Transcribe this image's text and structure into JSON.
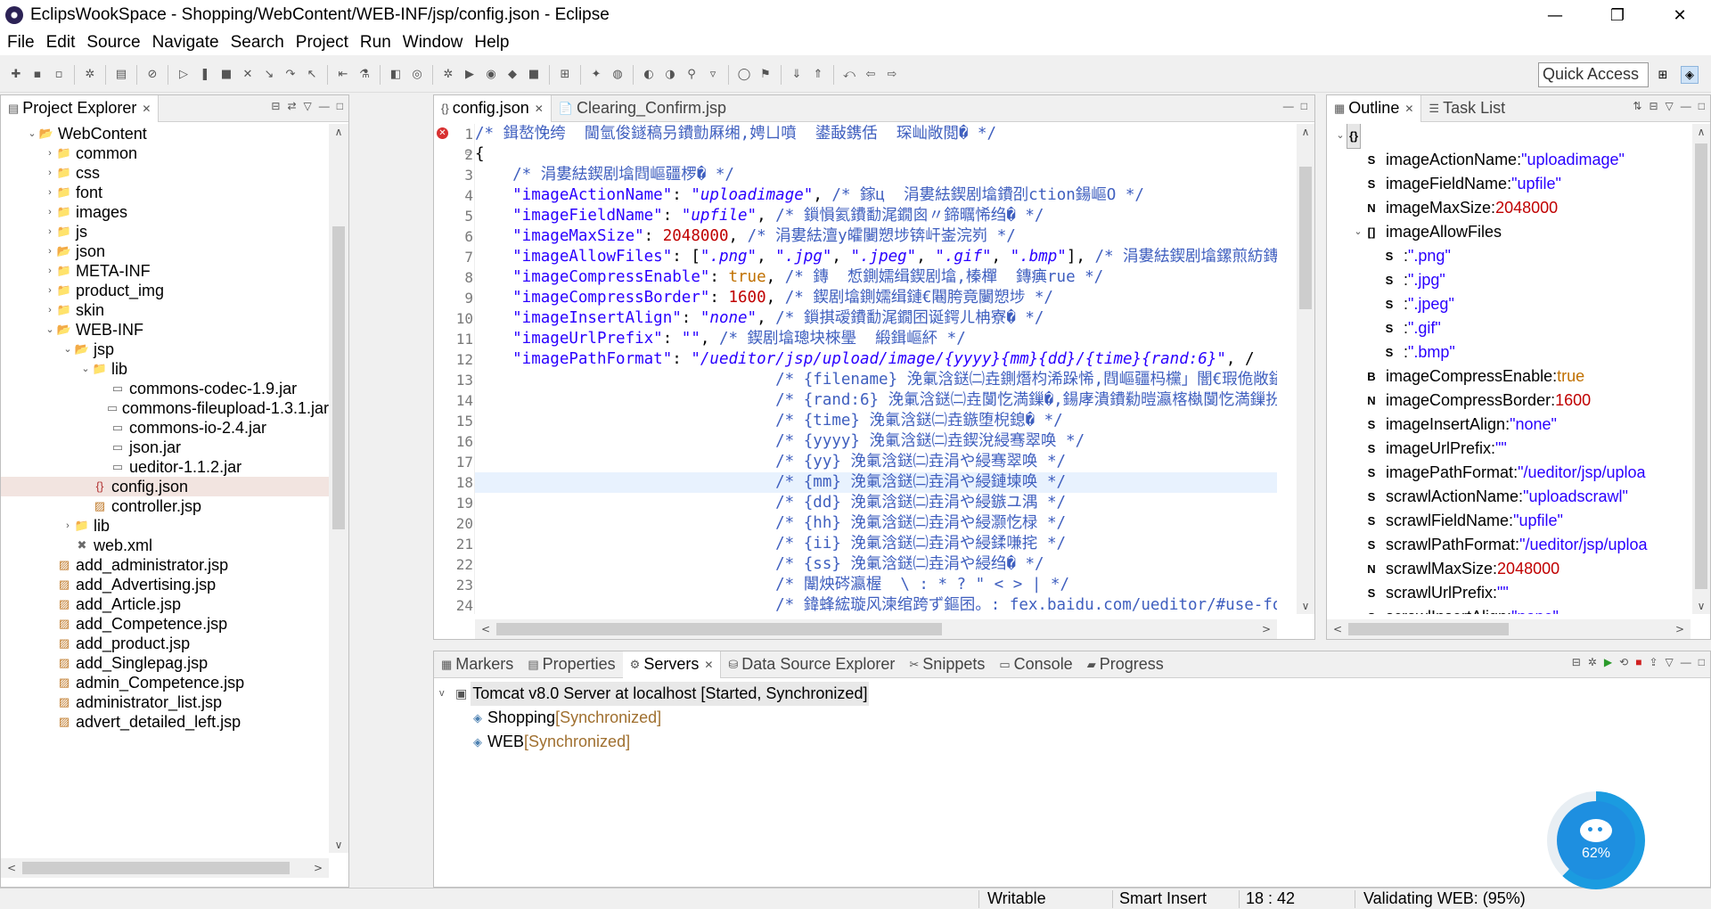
{
  "window": {
    "title": "EclipsWookSpace - Shopping/WebContent/WEB-INF/jsp/config.json - Eclipse",
    "minimize": "—",
    "maximize": "❐",
    "close": "✕"
  },
  "menu": [
    "File",
    "Edit",
    "Source",
    "Navigate",
    "Search",
    "Project",
    "Run",
    "Window",
    "Help"
  ],
  "quick_access": "Quick Access",
  "explorer": {
    "tab": "Project Explorer",
    "rows": [
      {
        "depth": 1,
        "tw": "v",
        "icon": "folder-project",
        "label": "WebContent"
      },
      {
        "depth": 2,
        "tw": ">",
        "icon": "folder",
        "label": "common"
      },
      {
        "depth": 2,
        "tw": ">",
        "icon": "folder",
        "label": "css"
      },
      {
        "depth": 2,
        "tw": ">",
        "icon": "folder",
        "label": "font"
      },
      {
        "depth": 2,
        "tw": ">",
        "icon": "folder",
        "label": "images"
      },
      {
        "depth": 2,
        "tw": ">",
        "icon": "folder",
        "label": "js"
      },
      {
        "depth": 2,
        "tw": ">",
        "icon": "folder-project",
        "label": "json"
      },
      {
        "depth": 2,
        "tw": ">",
        "icon": "folder",
        "label": "META-INF"
      },
      {
        "depth": 2,
        "tw": ">",
        "icon": "folder",
        "label": "product_img"
      },
      {
        "depth": 2,
        "tw": ">",
        "icon": "folder",
        "label": "skin"
      },
      {
        "depth": 2,
        "tw": "v",
        "icon": "folder-project",
        "label": "WEB-INF"
      },
      {
        "depth": 3,
        "tw": "v",
        "icon": "folder-project",
        "label": "jsp"
      },
      {
        "depth": 4,
        "tw": "v",
        "icon": "folder",
        "label": "lib"
      },
      {
        "depth": 5,
        "tw": "",
        "icon": "file",
        "label": "commons-codec-1.9.jar"
      },
      {
        "depth": 5,
        "tw": "",
        "icon": "file",
        "label": "commons-fileupload-1.3.1.jar"
      },
      {
        "depth": 5,
        "tw": "",
        "icon": "file",
        "label": "commons-io-2.4.jar"
      },
      {
        "depth": 5,
        "tw": "",
        "icon": "file",
        "label": "json.jar"
      },
      {
        "depth": 5,
        "tw": "",
        "icon": "file",
        "label": "ueditor-1.1.2.jar"
      },
      {
        "depth": 4,
        "tw": "",
        "icon": "json",
        "label": "config.json",
        "selected": true
      },
      {
        "depth": 4,
        "tw": "",
        "icon": "jsp",
        "label": "controller.jsp"
      },
      {
        "depth": 3,
        "tw": ">",
        "icon": "folder",
        "label": "lib"
      },
      {
        "depth": 3,
        "tw": "",
        "icon": "xml",
        "label": "web.xml"
      },
      {
        "depth": 2,
        "tw": "",
        "icon": "jsp",
        "label": "add_administrator.jsp"
      },
      {
        "depth": 2,
        "tw": "",
        "icon": "jsp",
        "label": "add_Advertising.jsp"
      },
      {
        "depth": 2,
        "tw": "",
        "icon": "jsp",
        "label": "add_Article.jsp"
      },
      {
        "depth": 2,
        "tw": "",
        "icon": "jsp",
        "label": "add_Competence.jsp"
      },
      {
        "depth": 2,
        "tw": "",
        "icon": "jsp",
        "label": "add_product.jsp"
      },
      {
        "depth": 2,
        "tw": "",
        "icon": "jsp",
        "label": "add_Singlepag.jsp"
      },
      {
        "depth": 2,
        "tw": "",
        "icon": "jsp",
        "label": "admin_Competence.jsp"
      },
      {
        "depth": 2,
        "tw": "",
        "icon": "jsp",
        "label": "administrator_list.jsp"
      },
      {
        "depth": 2,
        "tw": "",
        "icon": "jsp",
        "label": "advert_detailed_left.jsp"
      }
    ]
  },
  "editor": {
    "tabs": [
      {
        "label": "config.json",
        "icon": "{}",
        "active": true
      },
      {
        "label": "Clearing_Confirm.jsp",
        "icon": "📄",
        "active": false
      }
    ],
    "lines": [
      {
        "n": "1",
        "parts": [
          {
            "t": "/* 鍓嶅悗绔  閫氫俊鐩稿叧鐨勯厤缃,娉ㄩ噴  鍙敮鎸佸  琛屾敞閲� */",
            "c": "com"
          }
        ]
      },
      {
        "n": "2",
        "parts": [
          {
            "t": "{",
            "c": "punc"
          }
        ]
      },
      {
        "n": "3",
        "parts": [
          {
            "t": "    /* 涓婁紶鍥剧墖閰嶇疆椤� */",
            "c": "com"
          }
        ]
      },
      {
        "n": "4",
        "parts": [
          {
            "t": "    \"imageActionName\"",
            "c": "key"
          },
          {
            "t": ": ",
            "c": "punc"
          },
          {
            "t": "\"uploadimage\"",
            "c": "str"
          },
          {
            "t": ", ",
            "c": "punc"
          },
          {
            "t": "/* 鎵ц  涓婁紶鍥剧墖鐨刟ction鍚嶇О */",
            "c": "com"
          }
        ]
      },
      {
        "n": "5",
        "parts": [
          {
            "t": "    \"imageFieldName\"",
            "c": "key"
          },
          {
            "t": ": ",
            "c": "punc"
          },
          {
            "t": "\"upfile\"",
            "c": "str"
          },
          {
            "t": ", ",
            "c": "punc"
          },
          {
            "t": "/* 鎻愪氦鐨勫浘鐗囪〃鍗曞悕绉� */",
            "c": "com"
          }
        ]
      },
      {
        "n": "6",
        "parts": [
          {
            "t": "    \"imageMaxSize\"",
            "c": "key"
          },
          {
            "t": ": ",
            "c": "punc"
          },
          {
            "t": "2048000",
            "c": "num"
          },
          {
            "t": ", ",
            "c": "punc"
          },
          {
            "t": "/* 涓婁紶澶у皬闄愬埗锛屽崟浣峛 */",
            "c": "com"
          }
        ]
      },
      {
        "n": "7",
        "parts": [
          {
            "t": "    \"imageAllowFiles\"",
            "c": "key"
          },
          {
            "t": ": [",
            "c": "punc"
          },
          {
            "t": "\".png\"",
            "c": "str"
          },
          {
            "t": ", ",
            "c": "punc"
          },
          {
            "t": "\".jpg\"",
            "c": "str"
          },
          {
            "t": ", ",
            "c": "punc"
          },
          {
            "t": "\".jpeg\"",
            "c": "str"
          },
          {
            "t": ", ",
            "c": "punc"
          },
          {
            "t": "\".gif\"",
            "c": "str"
          },
          {
            "t": ", ",
            "c": "punc"
          },
          {
            "t": "\".bmp\"",
            "c": "str"
          },
          {
            "t": "], ",
            "c": "punc"
          },
          {
            "t": "/* 涓婁紶鍥剧墖鏍煎紡鏄剧ず */",
            "c": "com"
          }
        ]
      },
      {
        "n": "8",
        "parts": [
          {
            "t": "    \"imageCompressEnable\"",
            "c": "key"
          },
          {
            "t": ": ",
            "c": "punc"
          },
          {
            "t": "true",
            "c": "kw"
          },
          {
            "t": ", ",
            "c": "punc"
          },
          {
            "t": "/* 鏄  惁鍘嬬缉鍥剧墖,榛樿  鏄痶rue */",
            "c": "com"
          }
        ]
      },
      {
        "n": "9",
        "parts": [
          {
            "t": "    \"imageCompressBorder\"",
            "c": "key"
          },
          {
            "t": ": ",
            "c": "punc"
          },
          {
            "t": "1600",
            "c": "num"
          },
          {
            "t": ", ",
            "c": "punc"
          },
          {
            "t": "/* 鍥剧墖鍘嬬缉鏈€闀胯竟闄愬埗 */",
            "c": "com"
          }
        ]
      },
      {
        "n": "10",
        "parts": [
          {
            "t": "    \"imageInsertAlign\"",
            "c": "key"
          },
          {
            "t": ": ",
            "c": "punc"
          },
          {
            "t": "\"none\"",
            "c": "str"
          },
          {
            "t": ", ",
            "c": "punc"
          },
          {
            "t": "/* 鎻掑叆鐨勫浘鐗囨诞鍔ㄦ柟寮� */",
            "c": "com"
          }
        ]
      },
      {
        "n": "11",
        "parts": [
          {
            "t": "    \"imageUrlPrefix\"",
            "c": "key"
          },
          {
            "t": ": ",
            "c": "punc"
          },
          {
            "t": "\"\"",
            "c": "str"
          },
          {
            "t": ", ",
            "c": "punc"
          },
          {
            "t": "/* 鍥剧墖璁块棶璺  緞鍓嶇紑 */",
            "c": "com"
          }
        ]
      },
      {
        "n": "12",
        "parts": [
          {
            "t": "    \"imagePathFormat\"",
            "c": "key"
          },
          {
            "t": ": ",
            "c": "punc"
          },
          {
            "t": "\"/ueditor/jsp/upload/image/{yyyy}{mm}{dd}/{time}{rand:6}\"",
            "c": "str"
          },
          {
            "t": ", /",
            "c": "punc"
          }
        ]
      },
      {
        "n": "13",
        "parts": [
          {
            "t": "                                /* {filename} 浼氭浛鎹㈡垚鍘熸枃浠跺悕,閰嶇疆杩欓」闇€瑕佹敞鎰忎腑",
            "c": "com"
          }
        ]
      },
      {
        "n": "14",
        "parts": [
          {
            "t": "                                /* {rand:6} 浼氭浛鎹㈡垚闅忔満鏁�,鍚庨潰鐨勬暟瀛楁槸闅忔満鏁扮殑闀垮",
            "c": "com"
          }
        ]
      },
      {
        "n": "15",
        "parts": [
          {
            "t": "                                /* {time} 浼氭浛鎹㈡垚鏃堕棿鎴� */",
            "c": "com"
          }
        ]
      },
      {
        "n": "16",
        "parts": [
          {
            "t": "                                /* {yyyy} 浼氭浛鎹㈡垚鍥涗綅骞翠唤 */",
            "c": "com"
          }
        ]
      },
      {
        "n": "17",
        "parts": [
          {
            "t": "                                /* {yy} 浼氭浛鎹㈡垚涓や綅骞翠唤 */",
            "c": "com"
          }
        ]
      },
      {
        "n": "18",
        "parts": [
          {
            "t": "                                /* {mm} 浼氭浛鎹㈡垚涓や綅鏈堜唤 */",
            "c": "com"
          }
        ],
        "cur": true
      },
      {
        "n": "19",
        "parts": [
          {
            "t": "                                /* {dd} 浼氭浛鎹㈡垚涓や綅鏃ユ湡 */",
            "c": "com"
          }
        ]
      },
      {
        "n": "20",
        "parts": [
          {
            "t": "                                /* {hh} 浼氭浛鎹㈡垚涓や綅灏忔椂 */",
            "c": "com"
          }
        ]
      },
      {
        "n": "21",
        "parts": [
          {
            "t": "                                /* {ii} 浼氭浛鎹㈡垚涓や綅鍒嗛挓 */",
            "c": "com"
          }
        ]
      },
      {
        "n": "22",
        "parts": [
          {
            "t": "                                /* {ss} 浼氭浛鎹㈡垚涓や綅绉� */",
            "c": "com"
          }
        ]
      },
      {
        "n": "23",
        "parts": [
          {
            "t": "                                /* 闈炴硶瀛楃  \\ : * ? \" < > | */",
            "c": "com"
          }
        ]
      },
      {
        "n": "24",
        "parts": [
          {
            "t": "                                /* 鍏蜂綋璇风湅绾跨ず鏂囨。: fex.baidu.com/ueditor/#use-fo",
            "c": "com"
          }
        ]
      }
    ]
  },
  "outline": {
    "tabs": [
      {
        "label": "Outline",
        "active": true
      },
      {
        "label": "Task List",
        "active": false
      }
    ],
    "rows": [
      {
        "depth": 0,
        "tw": "v",
        "type": "{}",
        "key": "",
        "value": "",
        "vclass": ""
      },
      {
        "depth": 1,
        "tw": "",
        "type": "S",
        "key": "imageActionName",
        "value": "\"uploadimage\"",
        "vclass": "str"
      },
      {
        "depth": 1,
        "tw": "",
        "type": "S",
        "key": "imageFieldName",
        "value": "\"upfile\"",
        "vclass": "str"
      },
      {
        "depth": 1,
        "tw": "",
        "type": "N",
        "key": "imageMaxSize",
        "value": "2048000",
        "vclass": "num"
      },
      {
        "depth": 1,
        "tw": "v",
        "type": "[]",
        "key": "imageAllowFiles",
        "value": "",
        "vclass": ""
      },
      {
        "depth": 2,
        "tw": "",
        "type": "S",
        "key": "",
        "value": "\".png\"",
        "vclass": "str"
      },
      {
        "depth": 2,
        "tw": "",
        "type": "S",
        "key": "",
        "value": "\".jpg\"",
        "vclass": "str"
      },
      {
        "depth": 2,
        "tw": "",
        "type": "S",
        "key": "",
        "value": "\".jpeg\"",
        "vclass": "str"
      },
      {
        "depth": 2,
        "tw": "",
        "type": "S",
        "key": "",
        "value": "\".gif\"",
        "vclass": "str"
      },
      {
        "depth": 2,
        "tw": "",
        "type": "S",
        "key": "",
        "value": "\".bmp\"",
        "vclass": "str"
      },
      {
        "depth": 1,
        "tw": "",
        "type": "B",
        "key": "imageCompressEnable",
        "value": "true",
        "vclass": "bool"
      },
      {
        "depth": 1,
        "tw": "",
        "type": "N",
        "key": "imageCompressBorder",
        "value": "1600",
        "vclass": "num"
      },
      {
        "depth": 1,
        "tw": "",
        "type": "S",
        "key": "imageInsertAlign",
        "value": "\"none\"",
        "vclass": "str"
      },
      {
        "depth": 1,
        "tw": "",
        "type": "S",
        "key": "imageUrlPrefix",
        "value": "\"\"",
        "vclass": "str"
      },
      {
        "depth": 1,
        "tw": "",
        "type": "S",
        "key": "imagePathFormat",
        "value": "\"/ueditor/jsp/uploa",
        "vclass": "str"
      },
      {
        "depth": 1,
        "tw": "",
        "type": "S",
        "key": "scrawlActionName",
        "value": "\"uploadscrawl\"",
        "vclass": "str"
      },
      {
        "depth": 1,
        "tw": "",
        "type": "S",
        "key": "scrawlFieldName",
        "value": "\"upfile\"",
        "vclass": "str"
      },
      {
        "depth": 1,
        "tw": "",
        "type": "S",
        "key": "scrawlPathFormat",
        "value": "\"/ueditor/jsp/uploa",
        "vclass": "str"
      },
      {
        "depth": 1,
        "tw": "",
        "type": "N",
        "key": "scrawlMaxSize",
        "value": "2048000",
        "vclass": "num"
      },
      {
        "depth": 1,
        "tw": "",
        "type": "S",
        "key": "scrawlUrlPrefix",
        "value": "\"\"",
        "vclass": "str"
      },
      {
        "depth": 1,
        "tw": "",
        "type": "S",
        "key": "scrawlInsertAlign",
        "value": "\"none\"",
        "vclass": "str"
      }
    ]
  },
  "bottom": {
    "tabs": [
      {
        "label": "Markers",
        "active": false
      },
      {
        "label": "Properties",
        "active": false
      },
      {
        "label": "Servers",
        "active": true
      },
      {
        "label": "Data Source Explorer",
        "active": false
      },
      {
        "label": "Snippets",
        "active": false
      },
      {
        "label": "Console",
        "active": false
      },
      {
        "label": "Progress",
        "active": false
      }
    ],
    "server": "Tomcat v8.0 Server at localhost  [Started, Synchronized]",
    "modules": [
      {
        "name": "Shopping",
        "state": "[Synchronized]"
      },
      {
        "name": "WEB",
        "state": "[Synchronized]"
      }
    ]
  },
  "status": {
    "writable": "Writable",
    "insert": "Smart Insert",
    "position": "18 : 42",
    "validating": "Validating WEB: (95%)"
  },
  "widget": {
    "percent": "62%",
    "progress_fraction": 0.62
  }
}
